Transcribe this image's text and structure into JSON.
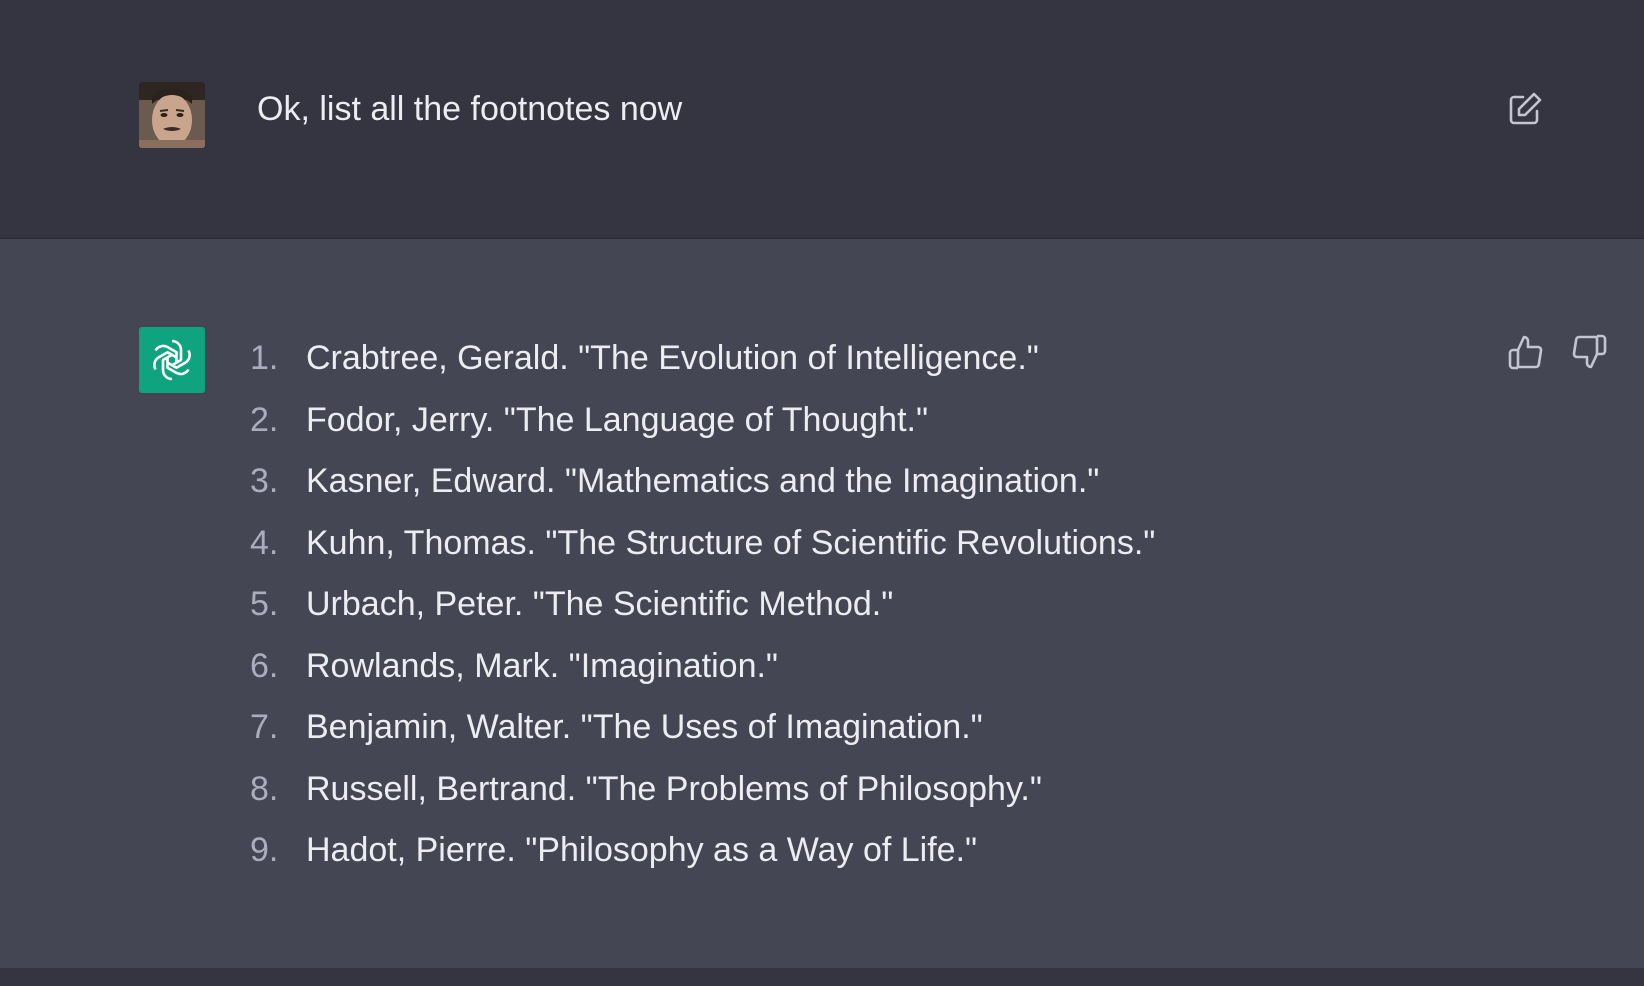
{
  "user_message": {
    "avatar": "user-photo-avatar",
    "text": "Ok, list all the footnotes now",
    "edit_icon": "edit-pencil-icon"
  },
  "assistant_message": {
    "avatar": "openai-logo-icon",
    "accent_color": "#10a37f",
    "footnotes": [
      {
        "num": "1.",
        "text": "Crabtree, Gerald. \"The Evolution of Intelligence.\""
      },
      {
        "num": "2.",
        "text": "Fodor, Jerry. \"The Language of Thought.\""
      },
      {
        "num": "3.",
        "text": "Kasner, Edward. \"Mathematics and the Imagination.\""
      },
      {
        "num": "4.",
        "text": "Kuhn, Thomas. \"The Structure of Scientific Revolutions.\""
      },
      {
        "num": "5.",
        "text": "Urbach, Peter. \"The Scientific Method.\""
      },
      {
        "num": "6.",
        "text": "Rowlands, Mark. \"Imagination.\""
      },
      {
        "num": "7.",
        "text": "Benjamin, Walter. \"The Uses of Imagination.\""
      },
      {
        "num": "8.",
        "text": "Russell, Bertrand. \"The Problems of Philosophy.\""
      },
      {
        "num": "9.",
        "text": "Hadot, Pierre. \"Philosophy as a Way of Life.\""
      }
    ],
    "feedback_icons": [
      "thumbs-up-icon",
      "thumbs-down-icon"
    ]
  },
  "colors": {
    "user_bg": "#343541",
    "assistant_bg": "#444654",
    "text": "#ececf1",
    "muted": "#acacbe"
  }
}
